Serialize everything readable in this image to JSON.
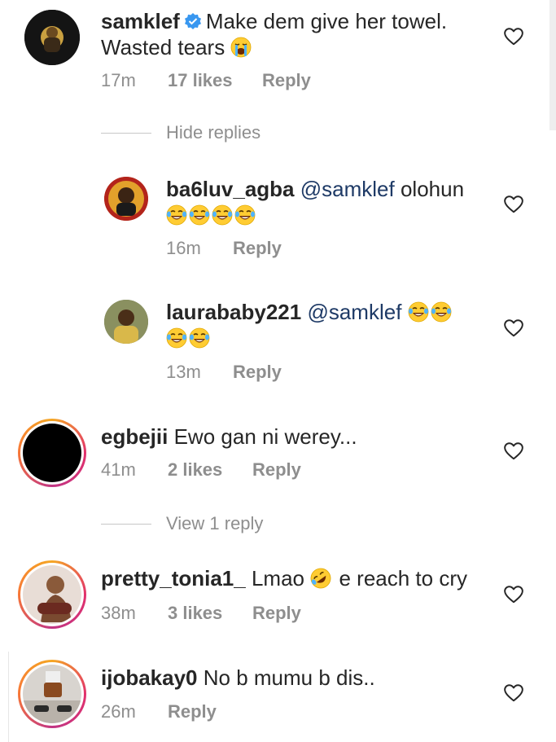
{
  "comments": [
    {
      "username": "samklef",
      "verified": true,
      "text": "Make dem give her towel. Wasted tears",
      "emoji": "crying-face",
      "time": "17m",
      "likes": "17 likes",
      "reply": "Reply"
    },
    {
      "username": "ba6luv_agba",
      "mention": "@samklef",
      "text": "olohun",
      "emoji_count": 4,
      "emoji": "tears-of-joy",
      "time": "16m",
      "reply": "Reply"
    },
    {
      "username": "laurababy221",
      "mention": "@samklef",
      "emoji": "tears-of-joy",
      "time": "13m",
      "reply": "Reply"
    },
    {
      "username": "egbejii",
      "text": "Ewo gan ni werey...",
      "time": "41m",
      "likes": "2 likes",
      "reply": "Reply"
    },
    {
      "username": "pretty_tonia1_",
      "text_before": "Lmao",
      "emoji": "rolling-on-floor-laughing",
      "text_after": "e reach to cry",
      "time": "38m",
      "likes": "3 likes",
      "reply": "Reply"
    },
    {
      "username": "ijobakay0",
      "text": "No b mumu b dis..",
      "time": "26m",
      "reply": "Reply"
    }
  ],
  "threads": {
    "hide_replies": "Hide replies",
    "view_replies": "View 1 reply"
  },
  "colors": {
    "mention": "#1e3a66",
    "secondary_text": "#8e8e8e",
    "verified": "#3897f0"
  }
}
